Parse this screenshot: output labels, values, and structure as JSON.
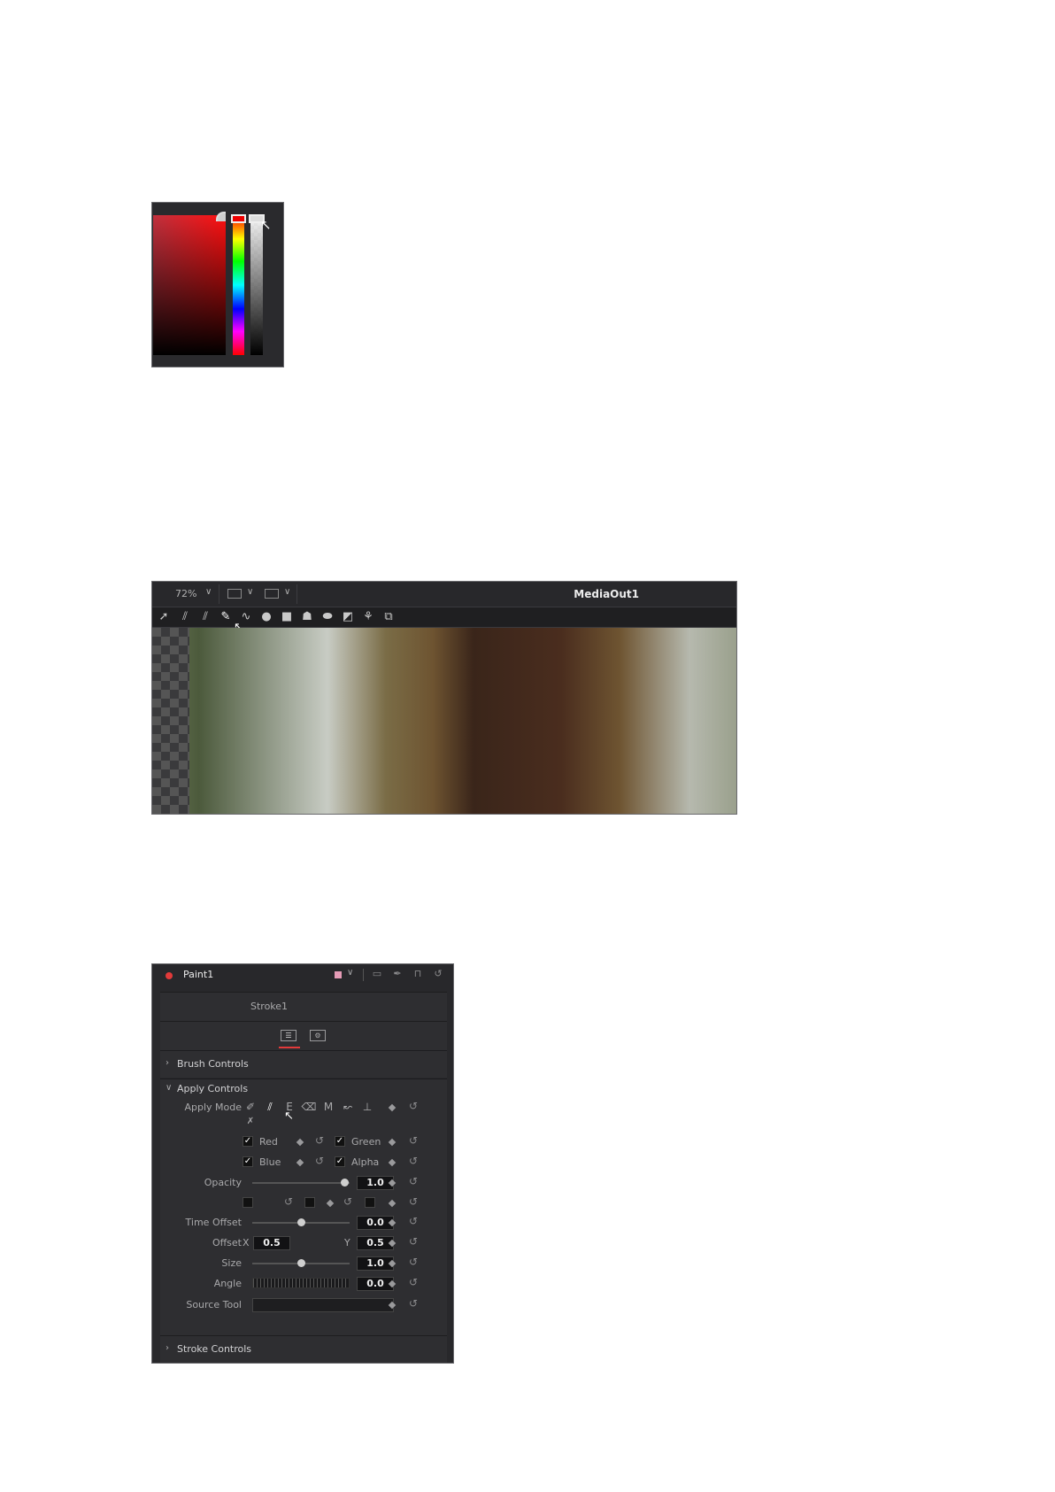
{
  "viewer": {
    "zoom": "72%",
    "title": "MediaOut1"
  },
  "inspector": {
    "node_name": "Paint1",
    "stroke_tab": "Stroke1",
    "sections": {
      "brush": "Brush Controls",
      "apply": "Apply Controls",
      "stroke": "Stroke Controls"
    },
    "labels": {
      "apply_mode": "Apply Mode",
      "red": "Red",
      "green": "Green",
      "blue": "Blue",
      "alpha": "Alpha",
      "opacity": "Opacity",
      "time_offset": "Time Offset",
      "offset": "Offset",
      "x": "X",
      "y": "Y",
      "size": "Size",
      "angle": "Angle",
      "source_tool": "Source Tool"
    },
    "values": {
      "opacity": "1.0",
      "time_offset": "0.0",
      "offset_x": "0.5",
      "offset_y": "0.5",
      "size": "1.0",
      "angle": "0.0"
    },
    "channels": {
      "red": true,
      "green": true,
      "blue": true,
      "alpha": true
    },
    "colors": {
      "node_dot": "#e23a3a",
      "swatch": "#e59bb6",
      "tab_underline": "#e23a3a"
    }
  },
  "icons": {
    "picker_cursor": "arrow-cursor-icon",
    "viewer_tools": [
      "select-icon",
      "multistroke-icon",
      "clone-multistroke-icon",
      "stroke-icon",
      "polyline-stroke-icon",
      "circle-icon",
      "rectangle-icon",
      "paint-group-icon",
      "bitmap-icon",
      "wand-icon",
      "copy-rect-icon",
      "copy-ellipse-icon"
    ],
    "apply_modes": [
      "color-mode-icon",
      "clone-mode-icon",
      "emboss-mode-icon",
      "erase-mode-icon",
      "merge-mode-icon",
      "smear-mode-icon",
      "stamp-mode-icon",
      "wire-mode-icon"
    ]
  }
}
